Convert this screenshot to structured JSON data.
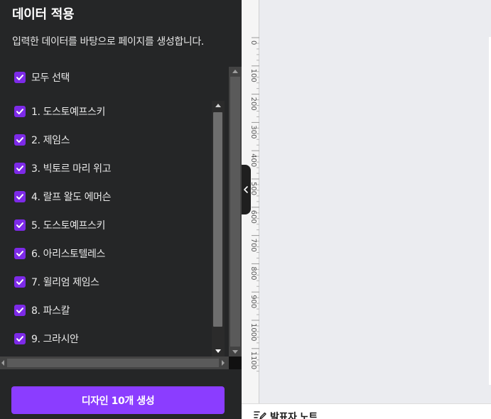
{
  "panel": {
    "title": "데이터 적용",
    "description": "입력한 데이터를 바탕으로 페이지를 생성합니다.",
    "select_all_label": "모두 선택",
    "select_all_checked": true,
    "items": [
      {
        "label": "1. 도스토예프스키",
        "checked": true
      },
      {
        "label": "2. 제임스",
        "checked": true
      },
      {
        "label": "3. 빅토르 마리 위고",
        "checked": true
      },
      {
        "label": "4. 랄프 왈도 에머슨",
        "checked": true
      },
      {
        "label": "5. 도스토예프스키",
        "checked": true
      },
      {
        "label": "6. 아리스토텔레스",
        "checked": true
      },
      {
        "label": "7. 윌리엄 제임스",
        "checked": true
      },
      {
        "label": "8. 파스칼",
        "checked": true
      },
      {
        "label": "9. 그라시안",
        "checked": true
      }
    ],
    "generate_button_label": "디자인 10개 생성"
  },
  "ruler": {
    "labels": [
      "0",
      "100",
      "200",
      "300",
      "400",
      "500",
      "600",
      "700",
      "800",
      "900",
      "1000",
      "1100"
    ]
  },
  "notes_bar": {
    "label": "발표자 노트",
    "icon": "edit-notes-icon"
  },
  "colors": {
    "panel_bg": "#252627",
    "accent": "#8b3dff",
    "checkbox": "#7d2ae8",
    "canvas_bg": "#ebecf0"
  }
}
